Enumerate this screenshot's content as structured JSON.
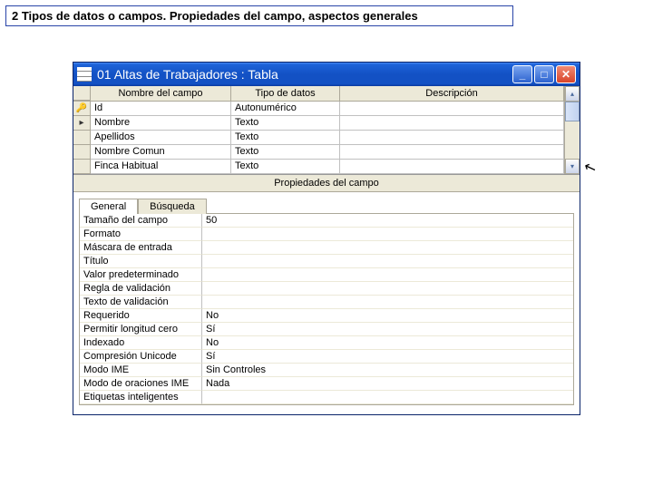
{
  "header": "2 Tipos de datos o campos. Propiedades del campo, aspectos generales",
  "window": {
    "title": "01 Altas de Trabajadores : Tabla"
  },
  "grid": {
    "columns": {
      "name": "Nombre del campo",
      "type": "Tipo de datos",
      "desc": "Descripción"
    },
    "rows": [
      {
        "sel": "key",
        "name": "Id",
        "type": "Autonumérico",
        "desc": ""
      },
      {
        "sel": "arrow",
        "name": "Nombre",
        "type": "Texto",
        "desc": ""
      },
      {
        "sel": "",
        "name": "Apellidos",
        "type": "Texto",
        "desc": ""
      },
      {
        "sel": "",
        "name": "Nombre Comun",
        "type": "Texto",
        "desc": ""
      },
      {
        "sel": "",
        "name": "Finca Habitual",
        "type": "Texto",
        "desc": ""
      }
    ]
  },
  "splitter": "Propiedades del campo",
  "tabs": {
    "general": "General",
    "busqueda": "Búsqueda"
  },
  "props": [
    {
      "label": "Tamaño del campo",
      "value": "50"
    },
    {
      "label": "Formato",
      "value": ""
    },
    {
      "label": "Máscara de entrada",
      "value": ""
    },
    {
      "label": "Título",
      "value": ""
    },
    {
      "label": "Valor predeterminado",
      "value": ""
    },
    {
      "label": "Regla de validación",
      "value": ""
    },
    {
      "label": "Texto de validación",
      "value": ""
    },
    {
      "label": "Requerido",
      "value": "No"
    },
    {
      "label": "Permitir longitud cero",
      "value": "Sí"
    },
    {
      "label": "Indexado",
      "value": "No"
    },
    {
      "label": "Compresión Unicode",
      "value": "Sí"
    },
    {
      "label": "Modo IME",
      "value": "Sin Controles"
    },
    {
      "label": "Modo de oraciones IME",
      "value": "Nada"
    },
    {
      "label": "Etiquetas inteligentes",
      "value": ""
    }
  ]
}
